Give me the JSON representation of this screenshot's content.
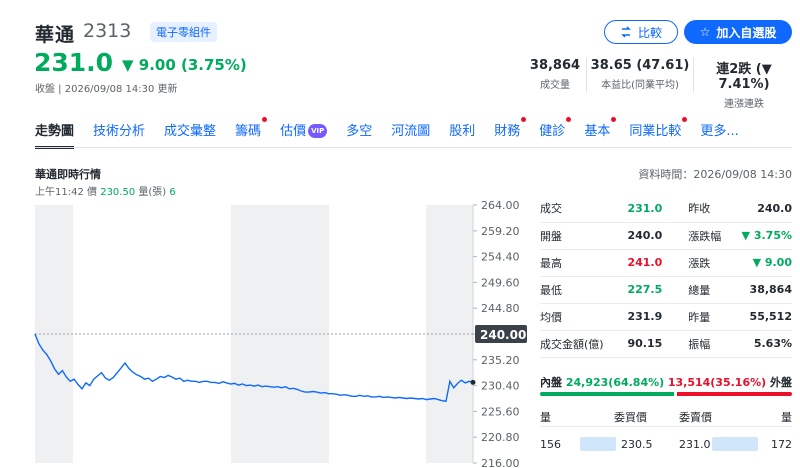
{
  "stock": {
    "name": "華通",
    "code": "2313",
    "sector_tag": "電子零組件",
    "price": "231.0",
    "change": "▼ 9.00 (3.75%)",
    "meta": "收盤 | 2026/09/08 14:30 更新"
  },
  "actions": {
    "compare_label": "比較",
    "watchlist_label": "加入自選股"
  },
  "stats": [
    {
      "value": "38,864",
      "label": "成交量"
    },
    {
      "value": "38.65 (47.61)",
      "label": "本益比(同業平均)"
    },
    {
      "value": "連2跌 (▼ 7.41%)",
      "label": "連漲連跌"
    }
  ],
  "tabs": [
    "走勢圖",
    "技術分析",
    "成交彙整",
    "籌碼",
    "估價",
    "多空",
    "河流圖",
    "股利",
    "財務",
    "健診",
    "基本",
    "同業比較",
    "更多..."
  ],
  "vip_badge": "VIP",
  "chart_header": {
    "title": "華通即時行情",
    "updated": "資料時間：2026/09/08 14:30",
    "time": "上午11:42",
    "price_label": "價",
    "price": "230.50",
    "volume_label": "量(張)",
    "volume": "6"
  },
  "quote_table": [
    {
      "l1": "成交",
      "v1": "231.0",
      "c1": "green",
      "l2": "昨收",
      "v2": "240.0",
      "c2": "dark"
    },
    {
      "l1": "開盤",
      "v1": "240.0",
      "c1": "dark",
      "l2": "漲跌幅",
      "v2": "▼ 3.75%",
      "c2": "green"
    },
    {
      "l1": "最高",
      "v1": "241.0",
      "c1": "red",
      "l2": "漲跌",
      "v2": "▼ 9.00",
      "c2": "green"
    },
    {
      "l1": "最低",
      "v1": "227.5",
      "c1": "green",
      "l2": "總量",
      "v2": "38,864",
      "c2": "dark"
    },
    {
      "l1": "均價",
      "v1": "231.9",
      "c1": "dark",
      "l2": "昨量",
      "v2": "55,512",
      "c2": "dark"
    },
    {
      "l1": "成交金額(億)",
      "v1": "90.15",
      "c1": "dark",
      "l2": "振幅",
      "v2": "5.63%",
      "c2": "dark"
    }
  ],
  "inner_outer": {
    "inner_label": "內盤",
    "inner": "24,923(64.84%)",
    "inner_fraction": 0.6484,
    "outer": "13,514(35.16%)",
    "outer_label": "外盤"
  },
  "order_book": {
    "headers": [
      "量",
      "委買價",
      "委賣價",
      "量"
    ],
    "rows": [
      {
        "bid_qty": "156",
        "bid": "230.5",
        "ask": "231.0",
        "ask_qty": "172"
      }
    ]
  },
  "colors": {
    "up": "#eb0f29",
    "down": "#00ab5e",
    "accent": "#0f69ff"
  },
  "chart_data": {
    "type": "line",
    "title": "",
    "xlabel": "",
    "ylabel": "",
    "ylim": [
      216.0,
      264.0
    ],
    "y_ticks": [
      "264.00",
      "259.20",
      "254.40",
      "249.60",
      "244.80",
      "240.00",
      "235.20",
      "230.40",
      "225.60",
      "220.80",
      "216.00"
    ],
    "reference_price": 240.0,
    "reference_label": "240.00",
    "series": [
      {
        "values": [
          240.0,
          238.2,
          237.0,
          236.2,
          235.0,
          233.5,
          232.5,
          233.2,
          232.0,
          231.2,
          231.6,
          230.6,
          229.8,
          230.9,
          230.4,
          231.6,
          232.2,
          232.8,
          231.8,
          231.4,
          231.9,
          232.8,
          233.7,
          234.6,
          233.6,
          232.9,
          232.4,
          232.1,
          231.6,
          231.8,
          231.2,
          231.6,
          232.1,
          231.9,
          232.3,
          232.0,
          231.6,
          231.8,
          231.2,
          231.4,
          231.2,
          231.2,
          231.0,
          231.2,
          231.2,
          231.0,
          231.0,
          230.8,
          231.1,
          230.9,
          230.7,
          230.8,
          230.5,
          230.7,
          230.4,
          230.5,
          230.3,
          230.5,
          230.2,
          230.3,
          230.2,
          230.1,
          230.2,
          230.0,
          230.2,
          229.8,
          229.9,
          229.7,
          229.4,
          229.2,
          229.2,
          229.3,
          229.2,
          229.0,
          229.1,
          228.9,
          228.9,
          228.8,
          228.6,
          228.7,
          228.6,
          228.4,
          228.4,
          228.6,
          228.4,
          228.5,
          228.3,
          228.3,
          228.4,
          228.2,
          228.3,
          228.2,
          228.1,
          228.2,
          228.1,
          228.0,
          228.1,
          228.0,
          227.9,
          228.0,
          227.8,
          227.9,
          228.0,
          227.8,
          227.6,
          227.5,
          231.2,
          230.0,
          230.8,
          231.4,
          230.9,
          231.2,
          231.0
        ]
      }
    ]
  }
}
